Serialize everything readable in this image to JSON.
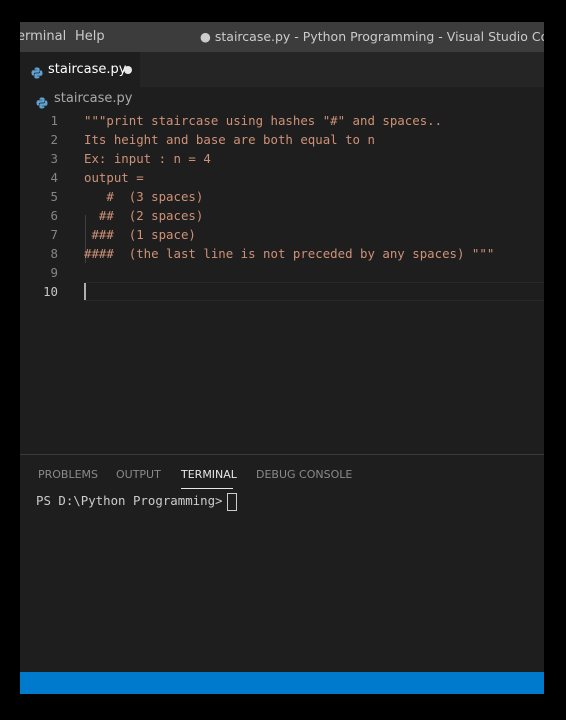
{
  "titlebar": {
    "menu_terminal": "erminal",
    "menu_help": "Help",
    "window_title": "● staircase.py - Python Programming - Visual Studio Code"
  },
  "tab": {
    "label": "staircase.py",
    "icon": "python-file-icon",
    "unsaved": true
  },
  "breadcrumb": {
    "label": "staircase.py",
    "icon": "python-file-icon"
  },
  "editor": {
    "active_line": 10,
    "lines": [
      {
        "n": "1",
        "text": "\"\"\"print staircase using hashes \"#\" and spaces.."
      },
      {
        "n": "2",
        "text": "Its height and base are both equal to n"
      },
      {
        "n": "3",
        "text": "Ex: input : n = 4"
      },
      {
        "n": "4",
        "text": "output ="
      },
      {
        "n": "5",
        "text": "   #  (3 spaces)"
      },
      {
        "n": "6",
        "text": "  ##  (2 spaces)"
      },
      {
        "n": "7",
        "text": " ###  (1 space)"
      },
      {
        "n": "8",
        "text": "####  (the last line is not preceded by any spaces) \"\"\""
      },
      {
        "n": "9",
        "text": ""
      },
      {
        "n": "10",
        "text": ""
      }
    ]
  },
  "panel": {
    "tabs": [
      "PROBLEMS",
      "OUTPUT",
      "TERMINAL",
      "DEBUG CONSOLE"
    ],
    "active_tab": "TERMINAL",
    "terminal_prompt": "PS D:\\Python Programming> "
  },
  "colors": {
    "string": "#ce9178",
    "background": "#1e1e1e",
    "titlebar": "#3c3c3c",
    "statusbar": "#007acc"
  }
}
